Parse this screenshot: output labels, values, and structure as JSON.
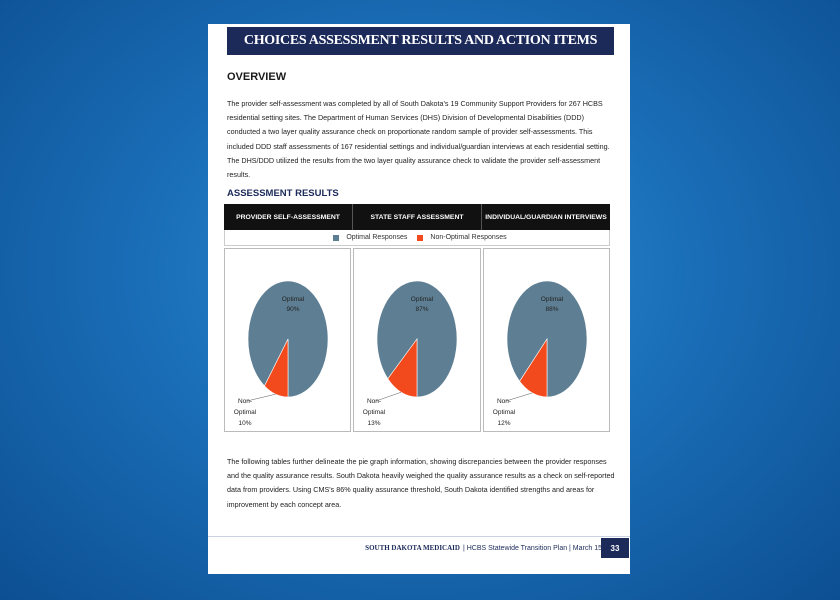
{
  "document": {
    "banner_title": "CHOICES ASSESSMENT RESULTS AND ACTION ITEMS",
    "overview_heading": "OVERVIEW",
    "overview_paragraph": "The provider self-assessment was completed by all of South Dakota's 19 Community Support Providers for 267 HCBS residential setting sites. The Department of Human Services (DHS) Division of Developmental Disabilities (DDD) conducted a two layer quality assurance check on proportionate random sample of provider self-assessments. This included DDD staff assessments of 167 residential settings and individual/guardian interviews at each residential setting. The DHS/DDD utilized the results from the two layer quality assurance check to validate the provider self-assessment results.",
    "results_heading": "ASSESSMENT RESULTS",
    "closing_paragraph": "The following tables further delineate the pie graph information, showing discrepancies between the provider responses and the quality assurance results.  South Dakota heavily weighed the quality assurance results as a check on self-reported data from providers. Using CMS's 86% quality assurance threshold, South Dakota identified strengths and areas for improvement by each concept area.",
    "footer_brand": "SOUTH DAKOTA MEDICAID",
    "footer_text": "| HCBS Statewide Transition Plan | March 15",
    "page_number": "33"
  },
  "chart_data": {
    "type": "pie",
    "legend": [
      "Optimal Responses",
      "Non-Optimal Responses"
    ],
    "colors": {
      "optimal": "#5e7f93",
      "non_optimal": "#f24a1c"
    },
    "charts": [
      {
        "title": "PROVIDER SELF-ASSESSMENT",
        "optimal_label": "Optimal",
        "optimal_pct": 90,
        "optimal_pct_text": "90%",
        "non_optimal_label_1": "Non-",
        "non_optimal_label_2": "Optimal",
        "non_optimal_pct": 10,
        "non_optimal_pct_text": "10%"
      },
      {
        "title": "STATE STAFF ASSESSMENT",
        "optimal_label": "Optimal",
        "optimal_pct": 87,
        "optimal_pct_text": "87%",
        "non_optimal_label_1": "Non-",
        "non_optimal_label_2": "Optimal",
        "non_optimal_pct": 13,
        "non_optimal_pct_text": "13%"
      },
      {
        "title": "INDIVIDUAL/GUARDIAN INTERVIEWS",
        "optimal_label": "Optimal",
        "optimal_pct": 88,
        "optimal_pct_text": "88%",
        "non_optimal_label_1": "Non-",
        "non_optimal_label_2": "Optimal",
        "non_optimal_pct": 12,
        "non_optimal_pct_text": "12%"
      }
    ]
  }
}
